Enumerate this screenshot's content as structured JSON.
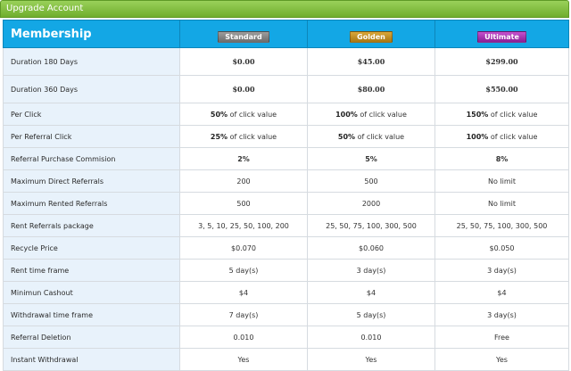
{
  "panel": {
    "title": "Upgrade Account"
  },
  "header": {
    "membership_label": "Membership",
    "plans": [
      "Standard",
      "Golden",
      "Ultimate"
    ]
  },
  "colors": {
    "standard": "#7f7f7f",
    "golden": "#c38e22",
    "ultimate": "#a73db1",
    "price_green": "#46a53a",
    "header_blue": "#13a7e5"
  },
  "rows": [
    {
      "label": "Duration 180 Days",
      "values": [
        "$0.00",
        "$45.00",
        "$299.00"
      ]
    },
    {
      "label": "Duration 360 Days",
      "values": [
        "$0.00",
        "$80.00",
        "$550.00"
      ]
    },
    {
      "label": "Per Click",
      "values": [
        {
          "bold": "50%",
          "rest": " of click value"
        },
        {
          "bold": "100%",
          "rest": " of click value"
        },
        {
          "bold": "150%",
          "rest": " of click value"
        }
      ]
    },
    {
      "label": "Per Referral Click",
      "values": [
        {
          "bold": "25%",
          "rest": " of click value"
        },
        {
          "bold": "50%",
          "rest": " of click value"
        },
        {
          "bold": "100%",
          "rest": " of click value"
        }
      ]
    },
    {
      "label": "Referral Purchase Commision",
      "values": [
        "2%",
        "5%",
        "8%"
      ]
    },
    {
      "label": "Maximum Direct Referrals",
      "values": [
        "200",
        "500",
        "No limit"
      ]
    },
    {
      "label": "Maximum Rented Referrals",
      "values": [
        "500",
        "2000",
        "No limit"
      ]
    },
    {
      "label": "Rent Referrals package",
      "values": [
        "3, 5, 10, 25, 50, 100, 200",
        "25, 50, 75, 100, 300, 500",
        "25, 50, 75, 100, 300, 500"
      ]
    },
    {
      "label": "Recycle Price",
      "values": [
        "$0.070",
        "$0.060",
        "$0.050"
      ]
    },
    {
      "label": "Rent time frame",
      "values": [
        "5 day(s)",
        "3 day(s)",
        "3 day(s)"
      ]
    },
    {
      "label": "Minimun Cashout",
      "values": [
        "$4",
        "$4",
        "$4"
      ]
    },
    {
      "label": "Withdrawal time frame",
      "values": [
        "7 day(s)",
        "5 day(s)",
        "3 day(s)"
      ]
    },
    {
      "label": "Referral Deletion",
      "values": [
        "0.010",
        "0.010",
        "Free"
      ]
    },
    {
      "label": "Instant Withdrawal",
      "values": [
        "Yes",
        "Yes",
        "Yes"
      ]
    }
  ]
}
